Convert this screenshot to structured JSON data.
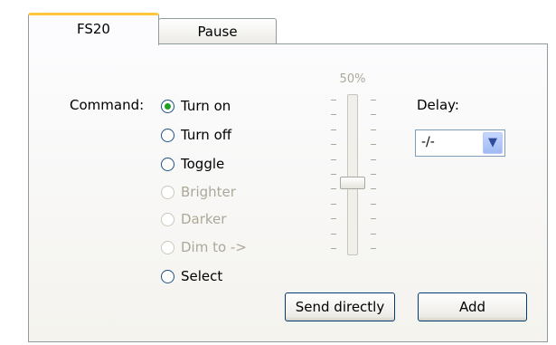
{
  "tabs": [
    {
      "label": "FS20",
      "active": true
    },
    {
      "label": "Pause",
      "active": false
    }
  ],
  "command": {
    "label": "Command:",
    "options": [
      {
        "label": "Turn on",
        "checked": true,
        "enabled": true
      },
      {
        "label": "Turn off",
        "checked": false,
        "enabled": true
      },
      {
        "label": "Toggle",
        "checked": false,
        "enabled": true
      },
      {
        "label": "Brighter",
        "checked": false,
        "enabled": false
      },
      {
        "label": "Darker",
        "checked": false,
        "enabled": false
      },
      {
        "label": "Dim to ->",
        "checked": false,
        "enabled": false
      },
      {
        "label": "Select",
        "checked": false,
        "enabled": true
      }
    ]
  },
  "dim_slider": {
    "value_label": "50%",
    "value": 0.5,
    "enabled": false
  },
  "delay": {
    "label": "Delay:",
    "selected": "-/-"
  },
  "buttons": {
    "send_directly": "Send directly",
    "add": "Add"
  },
  "colors": {
    "active_tab_accent": "#ffc83c",
    "radio_checked": "#21a121",
    "border": "#919b9c"
  }
}
